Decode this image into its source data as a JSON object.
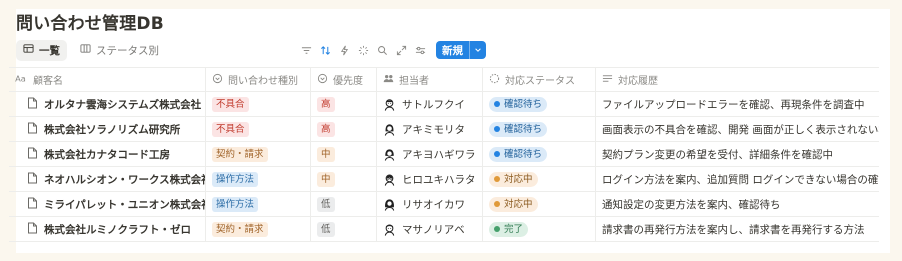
{
  "page": {
    "title": "問い合わせ管理DB"
  },
  "views": [
    {
      "label": "一覧",
      "icon": "table-icon",
      "active": true
    },
    {
      "label": "ステータス別",
      "icon": "board-icon",
      "active": false
    }
  ],
  "toolbar": {
    "icons": [
      "filter-icon",
      "sort-icon",
      "automation-icon",
      "ai-icon",
      "search-icon",
      "expand-icon",
      "settings-icon"
    ],
    "new_label": "新規"
  },
  "columns": [
    {
      "label": "顧客名",
      "icon": "text-icon"
    },
    {
      "label": "問い合わせ種別",
      "icon": "select-icon"
    },
    {
      "label": "優先度",
      "icon": "select-icon"
    },
    {
      "label": "担当者",
      "icon": "people-icon"
    },
    {
      "label": "対応ステータス",
      "icon": "status-icon"
    },
    {
      "label": "対応履歴",
      "icon": "lines-icon"
    }
  ],
  "rows": [
    {
      "customer": "オルタナ雲海システムズ株式会社",
      "type": "不具合",
      "priority": "高",
      "assignee": "サトルフクイ",
      "status": "確認待ち",
      "history": "ファイルアップロードエラーを確認、再現条件を調査中"
    },
    {
      "customer": "株式会社ソラノリズム研究所",
      "type": "不具合",
      "priority": "高",
      "assignee": "アキミモリタ",
      "status": "確認待ち",
      "history": "画面表示の不具合を確認、開発 画面が正しく表示されない場合"
    },
    {
      "customer": "株式会社カナタコード工房",
      "type": "契約・請求",
      "priority": "中",
      "assignee": "アキヨハギワラ",
      "status": "確認待ち",
      "history": "契約プラン変更の希望を受付、詳細条件を確認中"
    },
    {
      "customer": "ネオハルシオン・ワークス株式会社",
      "type": "操作方法",
      "priority": "中",
      "assignee": "ヒロユキハラタ",
      "status": "対応中",
      "history": "ログイン方法を案内、追加質問 ログインできない場合の確認手"
    },
    {
      "customer": "ミライパレット・ユニオン株式会社",
      "type": "操作方法",
      "priority": "低",
      "assignee": "リサオイカワ",
      "status": "対応中",
      "history": "通知設定の変更方法を案内、確認待ち"
    },
    {
      "customer": "株式会社ルミノクラフト・ゼロ",
      "type": "契約・請求",
      "priority": "低",
      "assignee": "マサノリアベ",
      "status": "完了",
      "history": "請求書の再発行方法を案内し、請求書を再発行する方法"
    }
  ],
  "colors": {
    "accent": "#2383e2",
    "type": {
      "不具合": [
        "#fbe4e4",
        "#c0392b"
      ],
      "契約・請求": [
        "#fbecdd",
        "#a0642a"
      ],
      "操作方法": [
        "#dbeaf8",
        "#2f6fa7"
      ]
    },
    "priority": {
      "高": [
        "#fbe4e4",
        "#c0392b"
      ],
      "中": [
        "#fbecdd",
        "#a0642a"
      ],
      "低": [
        "#ebeced",
        "#5f5e5b"
      ]
    },
    "status": {
      "確認待ち": [
        "#dbeaf8",
        "#1f5f99",
        "#2383e2"
      ],
      "対応中": [
        "#fbecdd",
        "#8a5a1f",
        "#e09a3a"
      ],
      "完了": [
        "#dcefe4",
        "#2f7a50",
        "#45a06b"
      ]
    }
  }
}
